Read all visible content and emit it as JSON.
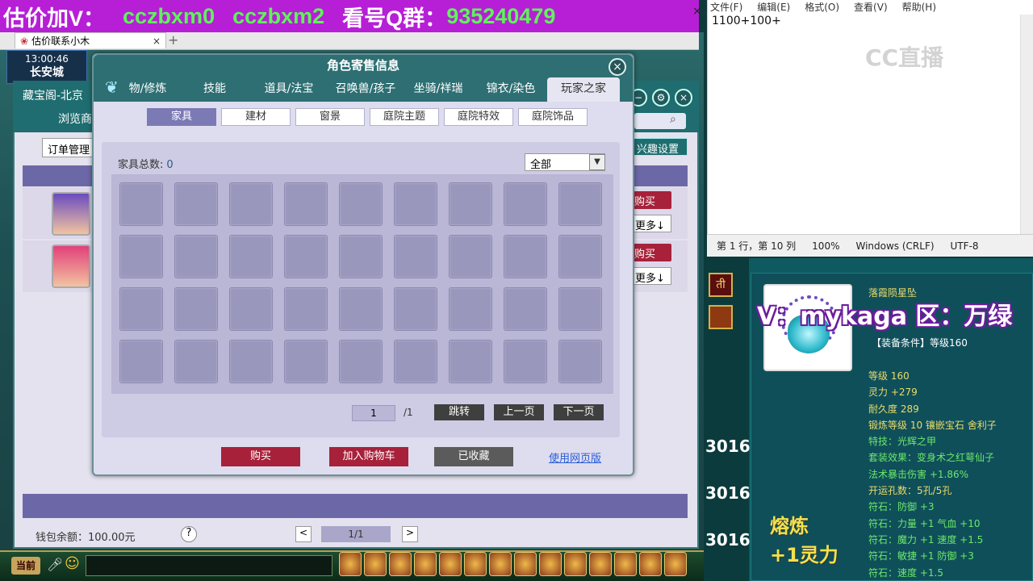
{
  "banner": {
    "part1": "估价加V：",
    "part2": "cczbxm0",
    "part3": "cczbxm2",
    "part4": "看号Q群：",
    "part5": "935240479",
    "close": "×"
  },
  "browser_tab": {
    "label": "估价联系小木",
    "close": "×",
    "add": "+"
  },
  "clock": {
    "time": "13:00:46",
    "city": "长安城"
  },
  "cbg": {
    "title": "藏宝阁-北京",
    "browse": "浏览商",
    "order": "订单管理",
    "interest": "兴趣设置",
    "buy": "购买",
    "more": "更多↓",
    "wallet": "钱包余额：100.00元",
    "help": "?",
    "page": "1/1",
    "prev": "<",
    "next": ">"
  },
  "modal": {
    "title": "角色寄售信息",
    "close": "×",
    "tabs": [
      "物/修炼",
      "技能",
      "道具/法宝",
      "召唤兽/孩子",
      "坐骑/祥瑞",
      "锦衣/染色",
      "玩家之家"
    ],
    "active_tab": 6,
    "subtabs": [
      "家具",
      "建材",
      "窗景",
      "庭院主题",
      "庭院特效",
      "庭院饰品"
    ],
    "active_subtab": 0,
    "count_label": "家具总数:",
    "count_value": "0",
    "filter": "全部",
    "page_current": "1",
    "page_total": "/1",
    "jump": "跳转",
    "prev_page": "上一页",
    "next_page": "下一页",
    "buy": "购买",
    "add_cart": "加入购物车",
    "favorited": "已收藏",
    "web_link": "使用网页版"
  },
  "notepad": {
    "menu": [
      "文件(F)",
      "编辑(E)",
      "格式(O)",
      "查看(V)",
      "帮助(H)"
    ],
    "text": "1100+100+",
    "status": [
      "第 1 行，第 10 列",
      "100%",
      "Windows (CRLF)",
      "UTF-8"
    ],
    "logo": "CC直播"
  },
  "tooltip": {
    "overlay": "V：mykaga  区：万绿",
    "name": "落霞陨星坠",
    "requirement": "【装备条件】等级160",
    "stats": [
      {
        "text": "等级 160",
        "color": "yellow"
      },
      {
        "text": "灵力 +279",
        "color": "yellow"
      },
      {
        "text": "耐久度 289",
        "color": "yellow"
      },
      {
        "text": "锻炼等级 10  镶嵌宝石 舍利子",
        "color": "yellow"
      },
      {
        "text": "特技：光辉之甲",
        "color": "green"
      },
      {
        "text": "套装效果：变身术之红萼仙子",
        "color": "green"
      },
      {
        "text": "法术暴击伤害 +1.86%",
        "color": "green"
      },
      {
        "text": "开运孔数：5孔/5孔",
        "color": "yellow"
      },
      {
        "text": "符石：防御 +3",
        "color": "green"
      },
      {
        "text": "符石：力量 +1  气血 +10",
        "color": "green"
      },
      {
        "text": "符石：魔力 +1  速度 +1.5",
        "color": "green"
      },
      {
        "text": "符石：敏捷 +1  防御 +3",
        "color": "green"
      },
      {
        "text": "符石：速度 +1.5",
        "color": "green"
      }
    ],
    "forge_title": "熔炼",
    "forge_value": "+1灵力"
  },
  "side": {
    "label_016": "3016",
    "btn": "ती"
  },
  "toolbar": {
    "current": "当前"
  }
}
